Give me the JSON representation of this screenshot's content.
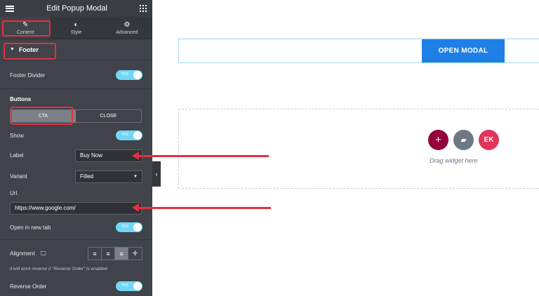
{
  "header": {
    "title": "Edit Popup Modal"
  },
  "tabs": [
    {
      "label": "Content",
      "icon": "pencil-icon"
    },
    {
      "label": "Style",
      "icon": "half-circle-icon"
    },
    {
      "label": "Advanced",
      "icon": "gear-icon"
    }
  ],
  "section": {
    "title": "Footer"
  },
  "footer_divider": {
    "label": "Footer Divider",
    "toggle": "YES"
  },
  "buttons": {
    "heading": "Buttons",
    "options": [
      "CTA",
      "CLOSE"
    ],
    "selected": "CTA"
  },
  "show": {
    "label": "Show",
    "toggle": "YES"
  },
  "label_field": {
    "label": "Label",
    "value": "Buy Now"
  },
  "variant": {
    "label": "Variant",
    "value": "Filled"
  },
  "url": {
    "label": "Url",
    "value": "https://www.google.com/"
  },
  "new_tab": {
    "label": "Open in new tab",
    "toggle": "YES"
  },
  "alignment": {
    "label": "Alignment",
    "note": "it will work reverse if \"Reverse Order\" is enabled."
  },
  "reverse": {
    "label": "Reverse Order",
    "toggle": "YES"
  },
  "canvas": {
    "open_button": "OPEN MODAL",
    "drag_text": "Drag widget here"
  },
  "colors": {
    "panel": "#404349",
    "accent_blue": "#1e80e6",
    "toggle": "#71d7f7",
    "annotation_red": "#e33040",
    "plus": "#93003a",
    "folder": "#6d7882",
    "ek": "#e2355a"
  }
}
